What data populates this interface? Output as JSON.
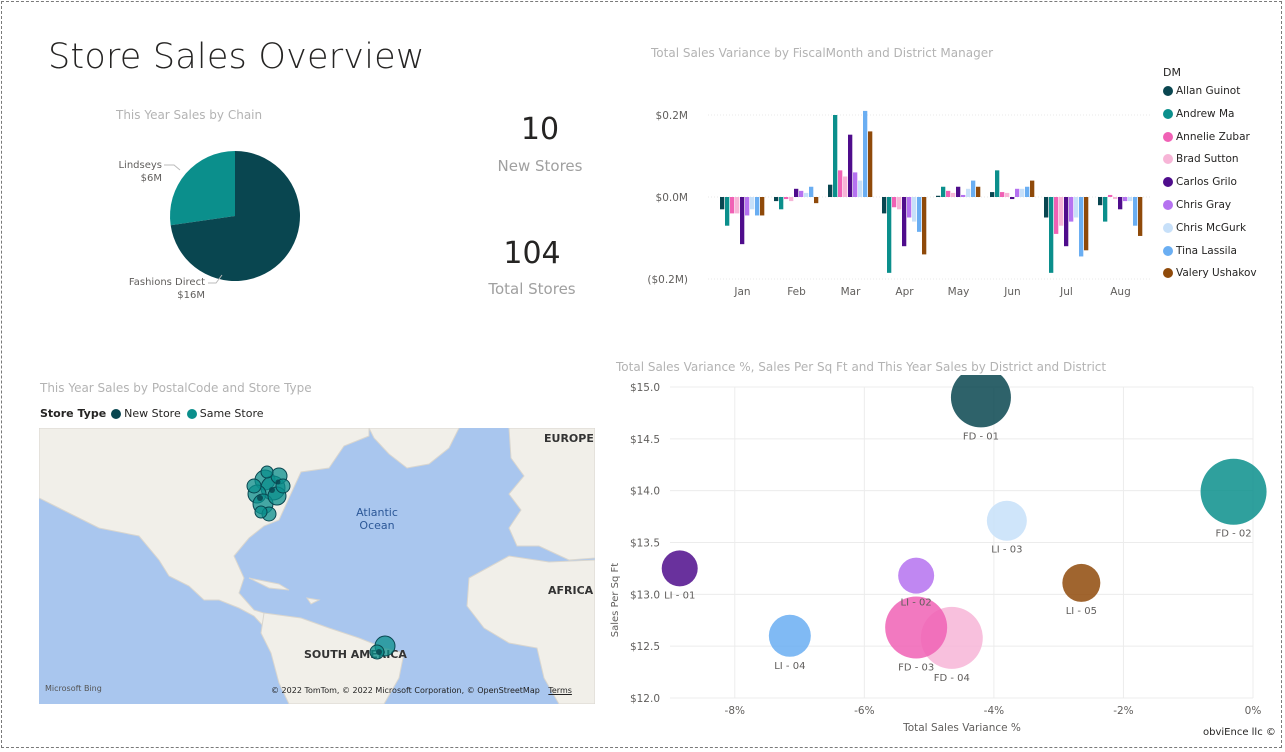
{
  "page": {
    "title": "Store Sales Overview",
    "footer": "obviEnce llc ©"
  },
  "pie": {
    "title": "This Year Sales by Chain",
    "slices": [
      {
        "name": "Lindseys",
        "value_label": "$6M",
        "value": 6,
        "color": "#0b8f8c"
      },
      {
        "name": "Fashions Direct",
        "value_label": "$16M",
        "value": 16,
        "color": "#094650"
      }
    ]
  },
  "cards": [
    {
      "value": "10",
      "label": "New Stores"
    },
    {
      "value": "104",
      "label": "Total Stores"
    }
  ],
  "bar_chart": {
    "title": "Total Sales Variance by FiscalMonth and District Manager",
    "legend_title": "DM",
    "y_ticks": [
      "$0.2M",
      "$0.0M",
      "($0.2M)"
    ]
  },
  "map": {
    "title": "This Year Sales by PostalCode and Store Type",
    "legend_title": "Store Type",
    "legend": [
      {
        "name": "New Store",
        "color": "#094650"
      },
      {
        "name": "Same Store",
        "color": "#0b8f8c"
      }
    ],
    "labels": {
      "europe": "EUROPE",
      "africa": "AFRICA",
      "south_america": "SOUTH AMERICA",
      "ocean": "Atlantic Ocean"
    },
    "attribution": "© 2022 TomTom, © 2022 Microsoft Corporation, © OpenStreetMap",
    "terms": "Terms",
    "bing": "Microsoft Bing"
  },
  "scatter": {
    "title": "Total Sales Variance %, Sales Per Sq Ft and This Year Sales by District and District",
    "xlabel": "Total Sales Variance %",
    "ylabel": "Sales Per Sq Ft"
  },
  "chart_data": [
    {
      "type": "pie",
      "title": "This Year Sales by Chain",
      "categories": [
        "Lindseys",
        "Fashions Direct"
      ],
      "values": [
        6,
        16
      ],
      "unit": "$M"
    },
    {
      "type": "bar",
      "title": "Total Sales Variance by FiscalMonth and District Manager",
      "categories": [
        "Jan",
        "Feb",
        "Mar",
        "Apr",
        "May",
        "Jun",
        "Jul",
        "Aug"
      ],
      "ylim": [
        -0.2,
        0.2
      ],
      "y_unit": "$M",
      "legend_title": "DM",
      "legend_position": "right",
      "series": [
        {
          "name": "Allan Guinot",
          "color": "#094650",
          "values": [
            -0.03,
            -0.01,
            0.03,
            -0.04,
            0.003,
            0.012,
            -0.05,
            -0.02
          ]
        },
        {
          "name": "Andrew Ma",
          "color": "#0b8f8c",
          "values": [
            -0.07,
            -0.03,
            0.2,
            -0.185,
            0.025,
            0.065,
            -0.185,
            -0.06
          ]
        },
        {
          "name": "Annelie Zubar",
          "color": "#f061b5",
          "values": [
            -0.04,
            -0.005,
            0.065,
            -0.025,
            0.015,
            0.012,
            -0.09,
            0.005
          ]
        },
        {
          "name": "Brad Sutton",
          "color": "#f7b5d7",
          "values": [
            -0.04,
            -0.01,
            0.05,
            -0.03,
            0.01,
            0.01,
            -0.07,
            -0.005
          ]
        },
        {
          "name": "Carlos Grilo",
          "color": "#4f0d8c",
          "values": [
            -0.115,
            0.02,
            0.152,
            -0.12,
            0.025,
            -0.005,
            -0.12,
            -0.03
          ]
        },
        {
          "name": "Chris Gray",
          "color": "#b572f0",
          "values": [
            -0.045,
            0.015,
            0.06,
            -0.05,
            0.005,
            0.02,
            -0.06,
            -0.01
          ]
        },
        {
          "name": "Chris McGurk",
          "color": "#c7e0f9",
          "values": [
            -0.03,
            0.01,
            0.04,
            -0.06,
            0.02,
            0.02,
            -0.05,
            -0.01
          ]
        },
        {
          "name": "Tina Lassila",
          "color": "#6aaef2",
          "values": [
            -0.045,
            0.025,
            0.21,
            -0.085,
            0.04,
            0.025,
            -0.145,
            -0.07
          ]
        },
        {
          "name": "Valery Ushakov",
          "color": "#8f4a0a",
          "values": [
            -0.045,
            -0.015,
            0.16,
            -0.14,
            0.025,
            0.04,
            -0.13,
            -0.095
          ]
        }
      ]
    },
    {
      "type": "scatter",
      "title": "Total Sales Variance %, Sales Per Sq Ft and This Year Sales by District and District",
      "xlabel": "Total Sales Variance %",
      "ylabel": "Sales Per Sq Ft",
      "xlim": [
        -9,
        0
      ],
      "ylim": [
        12.0,
        15.0
      ],
      "x_ticks": [
        -8,
        -6,
        -4,
        -2,
        0
      ],
      "y_ticks": [
        12.0,
        12.5,
        13.0,
        13.5,
        14.0,
        14.5,
        15.0
      ],
      "points": [
        {
          "label": "FD - 01",
          "x": -4.2,
          "y": 14.9,
          "size": 30,
          "color": "#094650"
        },
        {
          "label": "FD - 02",
          "x": -0.3,
          "y": 13.99,
          "size": 33,
          "color": "#0b8f8c"
        },
        {
          "label": "LI - 03",
          "x": -3.8,
          "y": 13.71,
          "size": 20,
          "color": "#c7e0f9"
        },
        {
          "label": "LI - 01",
          "x": -8.85,
          "y": 13.25,
          "size": 18,
          "color": "#4f0d8c"
        },
        {
          "label": "LI - 02",
          "x": -5.2,
          "y": 13.18,
          "size": 18,
          "color": "#b572f0"
        },
        {
          "label": "FD - 04",
          "x": -4.65,
          "y": 12.58,
          "size": 31,
          "color": "#f7b5d7"
        },
        {
          "label": "FD - 03",
          "x": -5.2,
          "y": 12.68,
          "size": 31,
          "color": "#f061b5"
        },
        {
          "label": "LI - 05",
          "x": -2.65,
          "y": 13.11,
          "size": 19,
          "color": "#8f4a0a"
        },
        {
          "label": "LI - 04",
          "x": -7.15,
          "y": 12.6,
          "size": 21,
          "color": "#6aaef2"
        }
      ]
    }
  ]
}
